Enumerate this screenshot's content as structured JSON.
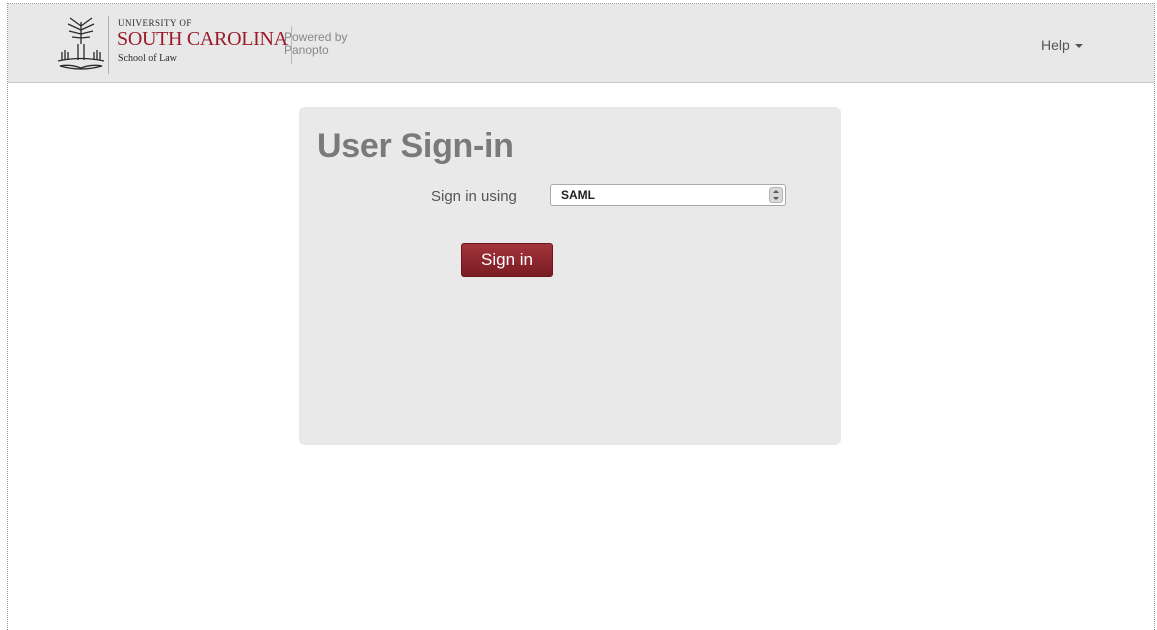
{
  "header": {
    "university_small": "UNIVERSITY OF",
    "university_big": "SOUTH CAROLINA",
    "school": "School of Law",
    "powered_line1": "Powered by",
    "powered_line2": "Panopto",
    "help_label": "Help"
  },
  "signin": {
    "title": "User Sign-in",
    "using_label": "Sign in using",
    "provider_selected": "SAML",
    "button_label": "Sign in"
  },
  "colors": {
    "brand": "#9b1b2a",
    "button": "#8a242b",
    "panel": "#e9e9e9",
    "topbar": "#e8e8e8"
  }
}
